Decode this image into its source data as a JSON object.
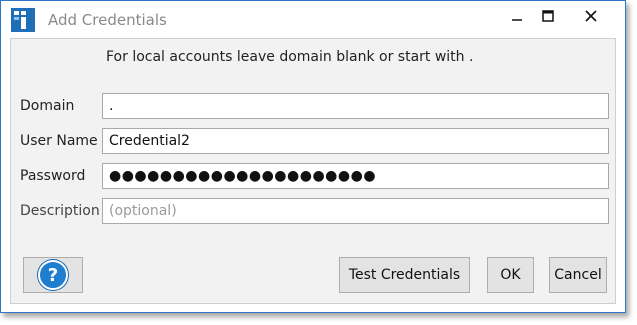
{
  "window": {
    "title": "Add Credentials",
    "controls": {
      "minimize": "–",
      "maximize": "□",
      "close": "✕"
    }
  },
  "form": {
    "hint": "For local accounts leave domain blank or start with .",
    "domain_label": "Domain",
    "domain_value": ".",
    "username_label": "User Name",
    "username_value": "Credential2",
    "password_label": "Password",
    "password_value": "●●●●●●●●●●●●●●●●●●●●●",
    "description_label": "Description",
    "description_placeholder": "(optional)"
  },
  "buttons": {
    "help": "?",
    "test": "Test Credentials",
    "ok": "OK",
    "cancel": "Cancel"
  },
  "colors": {
    "accent": "#1f7ed0",
    "window_border": "#2b79c2"
  }
}
